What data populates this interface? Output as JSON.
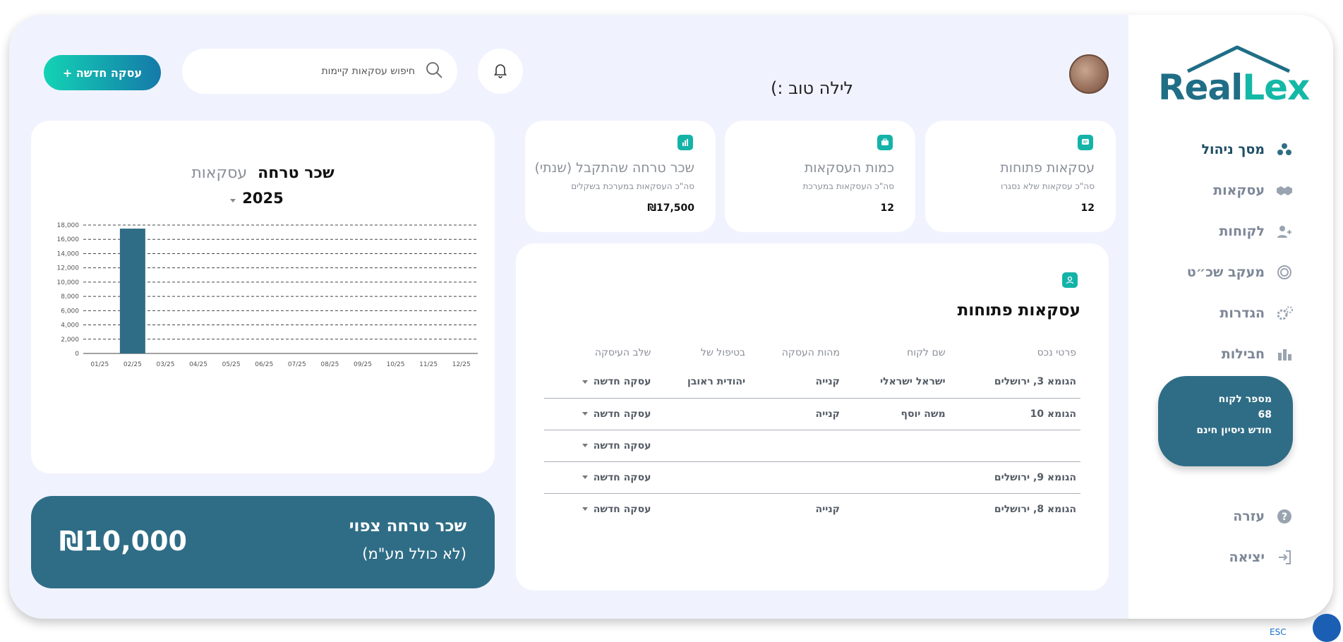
{
  "brand": {
    "part1": "Real",
    "part2": "Lex",
    "color": "#1f6e86",
    "accent": "#14b8a6"
  },
  "sidebar": {
    "items": [
      {
        "label": "מסך ניהול",
        "icon": "dashboard-icon",
        "active": true
      },
      {
        "label": "עסקאות",
        "icon": "handshake-icon"
      },
      {
        "label": "לקוחות",
        "icon": "add-user-icon"
      },
      {
        "label": "מעקב שכ״ט",
        "icon": "fee-tracking-icon"
      },
      {
        "label": "הגדרות",
        "icon": "gear-icon"
      },
      {
        "label": "חבילות",
        "icon": "packages-icon"
      }
    ],
    "account": {
      "line1": "מספר לקוח",
      "line2": "68",
      "line3": "חודש ניסיון חינם"
    },
    "bottom_items": [
      {
        "label": "עזרה",
        "icon": "help-icon"
      },
      {
        "label": "יציאה",
        "icon": "logout-icon"
      }
    ]
  },
  "header": {
    "greeting": "לילה טוב :)",
    "search_placeholder": "חיפוש עסקאות קיימות",
    "new_deal_label": "עסקה חדשה +"
  },
  "stats": [
    {
      "title": "עסקאות פתוחות",
      "subtitle": "סה\"כ עסקאות שלא נסגרו",
      "value": "12",
      "icon": "chat-icon"
    },
    {
      "title": "כמות העסקאות",
      "subtitle": "סה\"כ העסקאות במערכת",
      "value": "12",
      "icon": "briefcase-icon"
    },
    {
      "title": "שכר טרחה שהתקבל (שנתי)",
      "subtitle": "סה\"כ העסקאות במערכת בשקלים",
      "value": "₪17,500",
      "icon": "bar-chart-icon"
    }
  ],
  "open_deals": {
    "title": "עסקאות פתוחות",
    "columns": [
      "פרטי נכס",
      "שם לקוח",
      "מהות העסקה",
      "בטיפול של",
      "שלב העיסקה"
    ],
    "rows": [
      [
        "הגומא 3, ירושלים",
        "ישראל ישראלי",
        "קנייה",
        "יהודית ראובן",
        "עסקה חדשה"
      ],
      [
        "הגומא 10",
        "משה יוסף",
        "קנייה",
        "",
        "עסקה חדשה"
      ],
      [
        "",
        "",
        "",
        "",
        "עסקה חדשה"
      ],
      [
        "הגומא 9, ירושלים",
        "",
        "",
        "",
        "עסקה חדשה"
      ],
      [
        "הגומא 8, ירושלים",
        "",
        "קנייה",
        "",
        "עסקה חדשה"
      ]
    ]
  },
  "chart_panel": {
    "title": "שכר טרחה",
    "toggle": "עסקאות",
    "year": "2025"
  },
  "chart_data": {
    "type": "bar",
    "categories": [
      "01/25",
      "02/25",
      "03/25",
      "04/25",
      "05/25",
      "06/25",
      "07/25",
      "08/25",
      "09/25",
      "10/25",
      "11/25",
      "12/25"
    ],
    "values": [
      0,
      17500,
      0,
      0,
      0,
      0,
      0,
      0,
      0,
      0,
      0,
      0
    ],
    "ylim": [
      0,
      18000
    ],
    "yticks": [
      "0",
      "2,000",
      "4,000",
      "6,000",
      "8,000",
      "10,000",
      "12,000",
      "14,000",
      "16,000",
      "18,000"
    ],
    "grid": true,
    "bar_color": "#2f6d86"
  },
  "forecast": {
    "title": "שכר טרחה צפוי",
    "subtitle": "(לא כולל מע\"מ)",
    "value": "₪10,000"
  },
  "footer": {
    "esc": "ESC"
  }
}
